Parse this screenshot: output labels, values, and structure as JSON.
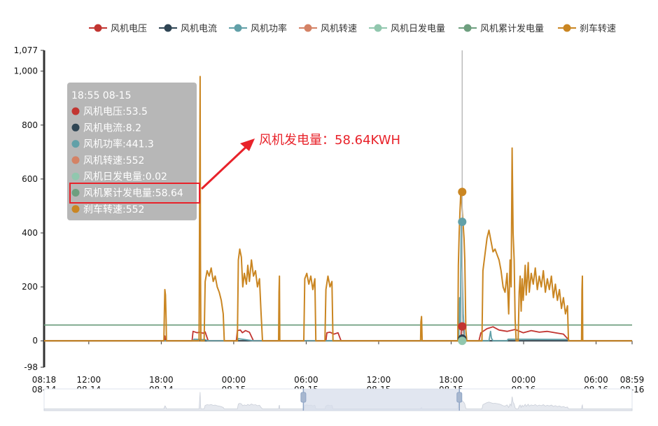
{
  "colors": {
    "voltage": "#c23531",
    "current": "#2f4554",
    "power": "#61a0a8",
    "speed": "#d48265",
    "daily": "#91c7ae",
    "cumulative": "#6e9f7f",
    "brake": "#ca8622",
    "annotation": "#e8222a",
    "axis": "#333333",
    "tooltip_bg": "#b3b3b3",
    "slider_window": "#d7deeb"
  },
  "chart_data": {
    "type": "line",
    "x_unit": "time",
    "x_range": [
      "08-14 08:18",
      "08-16 08:59"
    ],
    "y_ticks": [
      -98,
      0,
      200,
      400,
      600,
      800,
      1000,
      1077
    ],
    "ylim": [
      -98,
      1077
    ],
    "grid": false,
    "legend_position": "top-right",
    "x_ticks": [
      {
        "time": "08:18",
        "date": "08-14",
        "t": 0
      },
      {
        "time": "12:00",
        "date": "08-14",
        "t": 222
      },
      {
        "time": "18:00",
        "date": "08-14",
        "t": 582
      },
      {
        "time": "00:00",
        "date": "08-15",
        "t": 942
      },
      {
        "time": "06:00",
        "date": "08-15",
        "t": 1302
      },
      {
        "time": "12:00",
        "date": "08-15",
        "t": 1662
      },
      {
        "time": "18:00",
        "date": "08-15",
        "t": 2022
      },
      {
        "time": "00:00",
        "date": "08-16",
        "t": 2382
      },
      {
        "time": "06:00",
        "date": "08-16",
        "t": 2742
      },
      {
        "time": "08:59",
        "date": "08-16",
        "t": 2921
      }
    ],
    "series": [
      {
        "key": "voltage",
        "name": "风机电压",
        "points": [
          [
            0,
            0
          ],
          [
            595,
            0
          ],
          [
            600,
            18
          ],
          [
            603,
            0
          ],
          [
            735,
            0
          ],
          [
            740,
            35
          ],
          [
            760,
            30
          ],
          [
            770,
            32
          ],
          [
            790,
            28
          ],
          [
            800,
            33
          ],
          [
            815,
            0
          ],
          [
            955,
            0
          ],
          [
            960,
            38
          ],
          [
            975,
            40
          ],
          [
            985,
            30
          ],
          [
            1000,
            38
          ],
          [
            1020,
            32
          ],
          [
            1040,
            0
          ],
          [
            1400,
            0
          ],
          [
            1405,
            30
          ],
          [
            1420,
            32
          ],
          [
            1440,
            25
          ],
          [
            1460,
            30
          ],
          [
            1475,
            0
          ],
          [
            2070,
            0
          ],
          [
            2073,
            50
          ],
          [
            2078,
            55
          ],
          [
            2083,
            45
          ],
          [
            2090,
            0
          ],
          [
            2160,
            0
          ],
          [
            2170,
            30
          ],
          [
            2200,
            45
          ],
          [
            2230,
            52
          ],
          [
            2260,
            40
          ],
          [
            2300,
            35
          ],
          [
            2340,
            42
          ],
          [
            2380,
            30
          ],
          [
            2420,
            38
          ],
          [
            2460,
            32
          ],
          [
            2500,
            35
          ],
          [
            2540,
            30
          ],
          [
            2580,
            25
          ],
          [
            2610,
            0
          ],
          [
            2921,
            0
          ]
        ]
      },
      {
        "key": "current",
        "name": "风机电流",
        "points": [
          [
            0,
            0
          ],
          [
            2070,
            0
          ],
          [
            2073,
            10
          ],
          [
            2078,
            8
          ],
          [
            2085,
            0
          ],
          [
            2921,
            0
          ]
        ]
      },
      {
        "key": "power",
        "name": "风机功率",
        "points": [
          [
            0,
            0
          ],
          [
            740,
            0
          ],
          [
            745,
            6
          ],
          [
            800,
            4
          ],
          [
            815,
            0
          ],
          [
            960,
            0
          ],
          [
            965,
            8
          ],
          [
            1040,
            0
          ],
          [
            2060,
            0
          ],
          [
            2064,
            160
          ],
          [
            2068,
            60
          ],
          [
            2072,
            441
          ],
          [
            2076,
            300
          ],
          [
            2082,
            100
          ],
          [
            2090,
            0
          ],
          [
            2210,
            0
          ],
          [
            2214,
            18
          ],
          [
            2218,
            35
          ],
          [
            2222,
            10
          ],
          [
            2230,
            0
          ],
          [
            2300,
            0
          ],
          [
            2305,
            6
          ],
          [
            2600,
            5
          ],
          [
            2610,
            0
          ],
          [
            2921,
            0
          ]
        ]
      },
      {
        "key": "speed",
        "name": "风机转速",
        "points": [
          [
            0,
            0
          ],
          [
            2921,
            0
          ]
        ]
      },
      {
        "key": "daily",
        "name": "风机日发电量",
        "points": [
          [
            0,
            0
          ],
          [
            2921,
            0
          ]
        ]
      },
      {
        "key": "cumulative",
        "name": "风机累计发电量",
        "points": [
          [
            0,
            58.64
          ],
          [
            2921,
            58.64
          ]
        ]
      },
      {
        "key": "brake",
        "name": "刹车转速",
        "points": [
          [
            0,
            0
          ],
          [
            595,
            0
          ],
          [
            598,
            130
          ],
          [
            600,
            190
          ],
          [
            603,
            170
          ],
          [
            606,
            80
          ],
          [
            608,
            0
          ],
          [
            770,
            0
          ],
          [
            773,
            600
          ],
          [
            775,
            980
          ],
          [
            777,
            300
          ],
          [
            779,
            0
          ],
          [
            795,
            0
          ],
          [
            800,
            220
          ],
          [
            810,
            260
          ],
          [
            820,
            240
          ],
          [
            830,
            270
          ],
          [
            840,
            220
          ],
          [
            850,
            240
          ],
          [
            860,
            200
          ],
          [
            870,
            180
          ],
          [
            880,
            150
          ],
          [
            890,
            100
          ],
          [
            895,
            0
          ],
          [
            960,
            0
          ],
          [
            965,
            300
          ],
          [
            972,
            340
          ],
          [
            980,
            310
          ],
          [
            987,
            200
          ],
          [
            995,
            250
          ],
          [
            1005,
            210
          ],
          [
            1012,
            280
          ],
          [
            1020,
            220
          ],
          [
            1030,
            300
          ],
          [
            1040,
            240
          ],
          [
            1050,
            260
          ],
          [
            1060,
            200
          ],
          [
            1070,
            230
          ],
          [
            1078,
            100
          ],
          [
            1085,
            0
          ],
          [
            1165,
            0
          ],
          [
            1167,
            180
          ],
          [
            1169,
            240
          ],
          [
            1171,
            0
          ],
          [
            1290,
            0
          ],
          [
            1295,
            230
          ],
          [
            1305,
            250
          ],
          [
            1315,
            210
          ],
          [
            1325,
            240
          ],
          [
            1335,
            190
          ],
          [
            1345,
            230
          ],
          [
            1350,
            0
          ],
          [
            1395,
            0
          ],
          [
            1400,
            190
          ],
          [
            1410,
            240
          ],
          [
            1420,
            200
          ],
          [
            1430,
            220
          ],
          [
            1435,
            0
          ],
          [
            1870,
            0
          ],
          [
            1872,
            70
          ],
          [
            1875,
            90
          ],
          [
            1878,
            0
          ],
          [
            2055,
            0
          ],
          [
            2058,
            280
          ],
          [
            2062,
            400
          ],
          [
            2066,
            480
          ],
          [
            2070,
            552
          ],
          [
            2074,
            520
          ],
          [
            2078,
            470
          ],
          [
            2082,
            430
          ],
          [
            2086,
            380
          ],
          [
            2090,
            300
          ],
          [
            2095,
            40
          ],
          [
            2100,
            0
          ],
          [
            2175,
            0
          ],
          [
            2180,
            260
          ],
          [
            2190,
            320
          ],
          [
            2200,
            380
          ],
          [
            2210,
            410
          ],
          [
            2220,
            370
          ],
          [
            2230,
            330
          ],
          [
            2240,
            340
          ],
          [
            2250,
            320
          ],
          [
            2260,
            300
          ],
          [
            2270,
            260
          ],
          [
            2280,
            200
          ],
          [
            2290,
            180
          ],
          [
            2300,
            250
          ],
          [
            2308,
            100
          ],
          [
            2315,
            300
          ],
          [
            2320,
            200
          ],
          [
            2325,
            715
          ],
          [
            2330,
            400
          ],
          [
            2335,
            300
          ],
          [
            2340,
            80
          ],
          [
            2345,
            0
          ],
          [
            2355,
            0
          ],
          [
            2360,
            180
          ],
          [
            2365,
            240
          ],
          [
            2370,
            110
          ],
          [
            2375,
            230
          ],
          [
            2380,
            150
          ],
          [
            2385,
            210
          ],
          [
            2390,
            280
          ],
          [
            2395,
            170
          ],
          [
            2400,
            230
          ],
          [
            2405,
            290
          ],
          [
            2410,
            180
          ],
          [
            2420,
            250
          ],
          [
            2430,
            210
          ],
          [
            2440,
            270
          ],
          [
            2450,
            190
          ],
          [
            2460,
            240
          ],
          [
            2470,
            200
          ],
          [
            2480,
            260
          ],
          [
            2490,
            180
          ],
          [
            2500,
            230
          ],
          [
            2510,
            190
          ],
          [
            2520,
            240
          ],
          [
            2530,
            160
          ],
          [
            2540,
            210
          ],
          [
            2550,
            150
          ],
          [
            2560,
            190
          ],
          [
            2570,
            120
          ],
          [
            2580,
            160
          ],
          [
            2590,
            100
          ],
          [
            2600,
            130
          ],
          [
            2605,
            0
          ],
          [
            2670,
            0
          ],
          [
            2672,
            190
          ],
          [
            2674,
            240
          ],
          [
            2676,
            0
          ],
          [
            2921,
            0
          ]
        ]
      }
    ]
  },
  "slider": {
    "start_t": 1288,
    "end_t": 2063
  },
  "tooltip": {
    "title": "18:55 08-15",
    "items": [
      {
        "color": "#c23531",
        "text": "风机电压:53.5"
      },
      {
        "color": "#2f4554",
        "text": "风机电流:8.2"
      },
      {
        "color": "#61a0a8",
        "text": "风机功率:441.3"
      },
      {
        "color": "#d48265",
        "text": "风机转速:552"
      },
      {
        "color": "#91c7ae",
        "text": "风机日发电量:0.02"
      },
      {
        "color": "#6e9f7f",
        "text": "风机累计发电量:58.64"
      },
      {
        "color": "#ca8622",
        "text": "刹车转速:552"
      }
    ]
  },
  "annotation": {
    "text": "风机发电量：58.64KWH"
  },
  "cursor": {
    "t": 2077,
    "markers": [
      {
        "color": "#ca8622",
        "value": 552
      },
      {
        "color": "#61a0a8",
        "value": 441.3
      },
      {
        "color": "#c23531",
        "value": 53.5
      },
      {
        "color": "#2f4554",
        "value": 8.2
      },
      {
        "color": "#91c7ae",
        "value": 0.02
      }
    ]
  }
}
